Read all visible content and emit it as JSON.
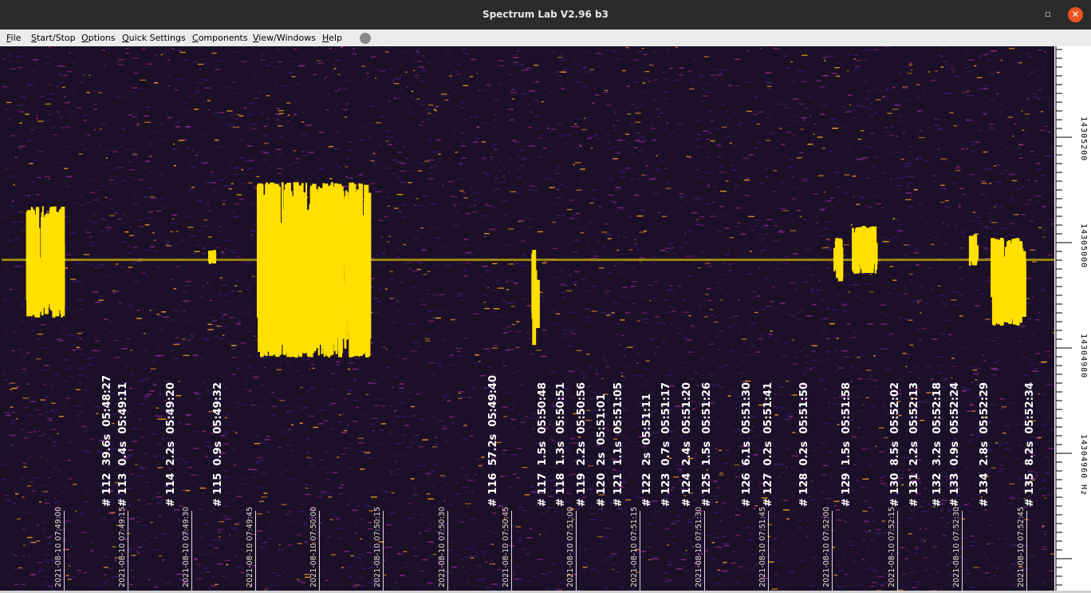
{
  "window": {
    "title": "Spectrum Lab V2.96 b3",
    "maximize_glyph": "▫",
    "close_glyph": "✕"
  },
  "menu": [
    "File",
    "Start/Stop",
    "Options",
    "Quick Settings",
    "Components",
    "View/Windows",
    "Help"
  ],
  "status_indicator": {
    "color": "#8a8a8a"
  },
  "frequency_axis": {
    "labels": [
      "14305200",
      "14305000",
      "14304980",
      "14304960 Hz"
    ]
  },
  "events": [
    "# 112  39.6s  05:48:27",
    "# 113  0.4s  05:49:11",
    "# 114  2.2s  05:49:20",
    "# 115  0.9s  05:49:32",
    "# 116  57.2s  05:49:40",
    "# 117  1.5s  05:50:48",
    "# 118  1.3s  05:50:51",
    "# 119  2.2s  05:50:56",
    "# 120  2s  05:51:01",
    "# 121  1.1s  05:51:05",
    "# 122  2s  05:51:11",
    "# 123  0.7s  05:51:17",
    "# 124  2.4s  05:51:20",
    "# 125  1.5s  05:51:26",
    "# 126  6.1s  05:51:30",
    "# 127  0.2s  05:51:41",
    "# 128  0.2s  05:51:50",
    "# 129  1.5s  05:51:58",
    "# 130  8.5s  05:52:02",
    "# 131  2.2s  05:52:13",
    "# 132  3.2s  05:52:18",
    "# 133  0.9s  05:52:24",
    "# 134  2.8s  05:52:29",
    "# 135  8.2s  05:52:34"
  ],
  "timestamps": [
    "2021-08-10 07:49:00",
    "2021-08-10 07:49:15",
    "2021-08-10 07:49:30",
    "2021-08-10 07:49:45",
    "2021-08-10 07:50:00",
    "2021-08-10 07:50:15",
    "2021-08-10 07:50:30",
    "2021-08-10 07:50:45",
    "2021-08-10 07:51:00",
    "2021-08-10 07:51:15",
    "2021-08-10 07:51:30",
    "2021-08-10 07:51:45",
    "2021-08-10 07:52:00",
    "2021-08-10 07:52:15",
    "2021-08-10 07:52:30",
    "2021-08-10 07:52:45"
  ],
  "colors": {
    "background": "#1c1028",
    "noise_low": "#3a1a6a",
    "noise_mid": "#8a2a8a",
    "noise_high": "#f0a020",
    "signal": "#ffe000"
  }
}
